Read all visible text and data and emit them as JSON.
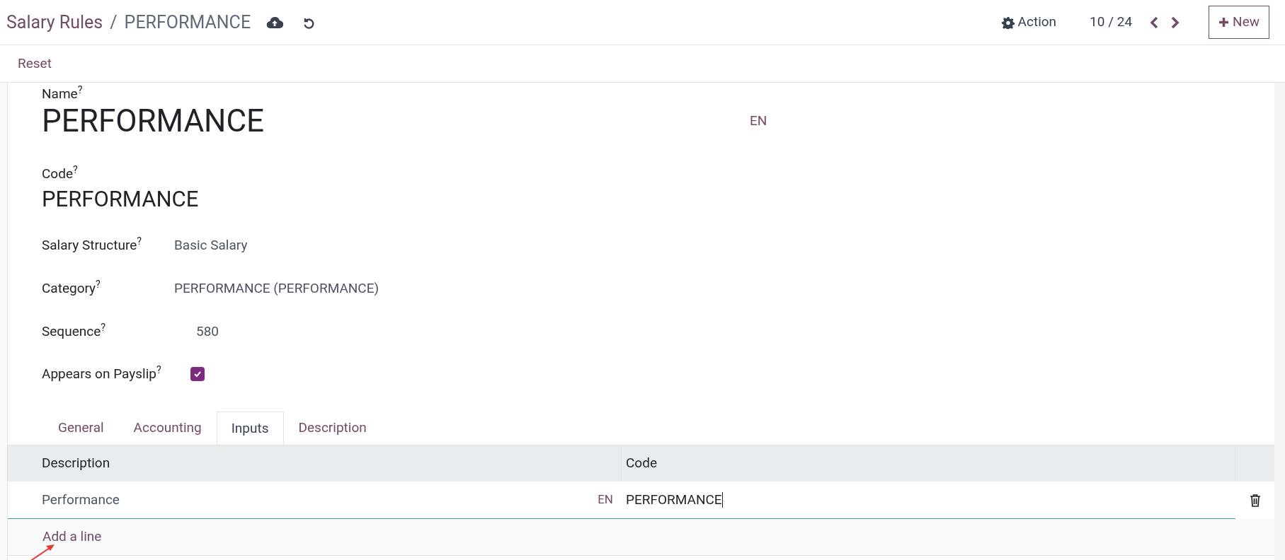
{
  "breadcrumb": {
    "parent": "Salary Rules",
    "separator": "/",
    "current": "PERFORMANCE"
  },
  "control_panel": {
    "action": "Action",
    "pager": "10 / 24",
    "new_button": "New"
  },
  "toolbar": {
    "reset": "Reset"
  },
  "form": {
    "name": {
      "label": "Name$^{?}$",
      "value": "PERFORMANCE",
      "lang": "EN"
    },
    "code": {
      "label": "Code$^{?}$",
      "value": "PERFORMANCE"
    },
    "fields": [
      {
        "label": "Salary Structure$^{?}$",
        "value": "Basic Salary",
        "kind": "text"
      },
      {
        "label": "Category$^{?}$",
        "value": "PERFORMANCE (PERFORMANCE)",
        "kind": "text"
      },
      {
        "label": "Sequence$^{?}$",
        "value": "580",
        "kind": "number"
      }
    ],
    "appears_on_payslip": {
      "label": "Appears on Payslip$^{?}$",
      "checked": true
    }
  },
  "tabs": [
    {
      "label": "General",
      "selected": false
    },
    {
      "label": "Accounting",
      "selected": false
    },
    {
      "label": "Inputs",
      "selected": true
    },
    {
      "label": "Description",
      "selected": false
    }
  ],
  "table": {
    "columns": [
      "Description",
      "Code"
    ],
    "rows": [
      {
        "description": "Performance",
        "lang": "EN",
        "code": "PERFORMANCE"
      }
    ],
    "add_line": "Add a line"
  }
}
